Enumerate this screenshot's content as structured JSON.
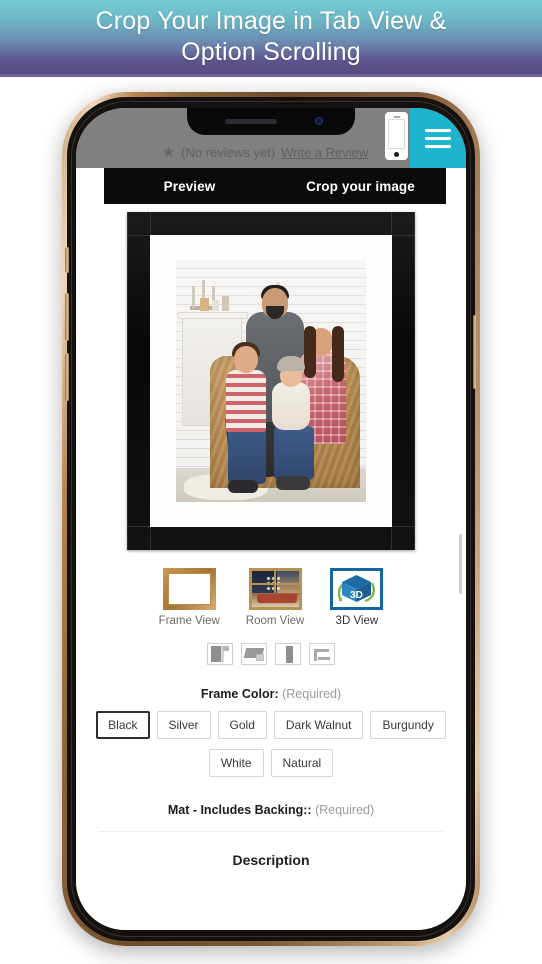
{
  "banner": {
    "line1": "Crop Your Image in Tab View &",
    "line2": "Option Scrolling"
  },
  "phone_app": {
    "background_page": {
      "reviews_text": "(No reviews yet)",
      "write_review_link": "Write a Review",
      "star_icon": "star-icon"
    },
    "menu_button": {
      "icon": "hamburger-menu-icon",
      "color": "#1eb4cf"
    },
    "phone_overlay_icon": "mobile-phone-icon",
    "tabs": [
      {
        "label": "Preview",
        "active": false
      },
      {
        "label": "Crop your image",
        "active": true
      }
    ],
    "artwork": {
      "frame_color": "#0b0b0b",
      "mat_color": "#fdfdfb",
      "photo_alt": "family-portrait-photo"
    },
    "view_options": [
      {
        "label": "Frame View",
        "icon": "frame-view-icon"
      },
      {
        "label": "Room View",
        "icon": "room-view-icon"
      },
      {
        "label": "3D View",
        "icon": "3d-view-icon"
      }
    ],
    "frame_profiles": [
      {
        "icon": "frame-profile-corner-icon"
      },
      {
        "icon": "frame-profile-angled-icon"
      },
      {
        "icon": "frame-profile-vertical-icon"
      },
      {
        "icon": "frame-profile-outline-icon"
      }
    ],
    "options": [
      {
        "title": "Frame Color:",
        "required_label": "(Required)",
        "choices": [
          {
            "label": "Black",
            "selected": true
          },
          {
            "label": "Silver",
            "selected": false
          },
          {
            "label": "Gold",
            "selected": false
          },
          {
            "label": "Dark Walnut",
            "selected": false
          },
          {
            "label": "Burgundy",
            "selected": false
          },
          {
            "label": "White",
            "selected": false
          },
          {
            "label": "Natural",
            "selected": false
          }
        ]
      },
      {
        "title": "Mat - Includes Backing::",
        "required_label": "(Required)",
        "choices": []
      }
    ],
    "description_heading": "Description"
  }
}
